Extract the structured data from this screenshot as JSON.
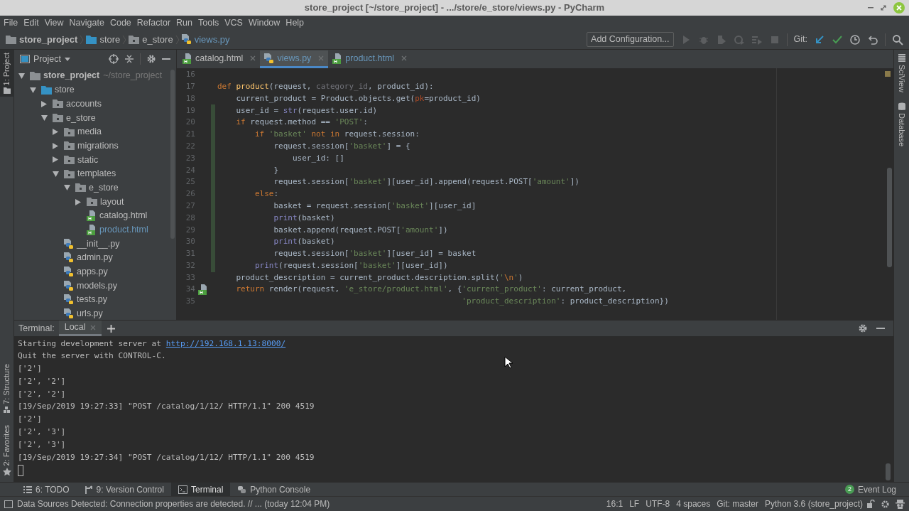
{
  "window": {
    "title": "store_project [~/store_project] - .../store/e_store/views.py - PyCharm"
  },
  "menu": [
    "File",
    "Edit",
    "View",
    "Navigate",
    "Code",
    "Refactor",
    "Run",
    "Tools",
    "VCS",
    "Window",
    "Help"
  ],
  "breadcrumb": [
    {
      "label": "store_project",
      "kind": "root"
    },
    {
      "label": "store",
      "kind": "source"
    },
    {
      "label": "e_store",
      "kind": "module"
    },
    {
      "label": "views.py",
      "kind": "py"
    }
  ],
  "toolbar": {
    "add_configuration": "Add Configuration...",
    "git_label": "Git:"
  },
  "left_stripe": {
    "top": [
      {
        "label": "1: Project",
        "selected": true
      }
    ],
    "bottom": [
      {
        "label": "7: Structure",
        "selected": false
      },
      {
        "label": "2: Favorites",
        "selected": false
      }
    ]
  },
  "right_stripe": [
    {
      "label": "SciView",
      "kind": "sciview"
    },
    {
      "label": "Database",
      "kind": "database"
    }
  ],
  "project_panel": {
    "title": "Project",
    "tree": [
      {
        "label": "store_project",
        "note": "~/store_project",
        "kind": "root",
        "expanded": true,
        "children": [
          {
            "label": "store",
            "kind": "source",
            "expanded": true,
            "children": [
              {
                "label": "accounts",
                "kind": "module",
                "expanded": false
              },
              {
                "label": "e_store",
                "kind": "module",
                "expanded": true,
                "children": [
                  {
                    "label": "media",
                    "kind": "module",
                    "expanded": false
                  },
                  {
                    "label": "migrations",
                    "kind": "module",
                    "expanded": false
                  },
                  {
                    "label": "static",
                    "kind": "module",
                    "expanded": false
                  },
                  {
                    "label": "templates",
                    "kind": "module",
                    "expanded": true,
                    "children": [
                      {
                        "label": "e_store",
                        "kind": "module",
                        "expanded": true,
                        "children": [
                          {
                            "label": "layout",
                            "kind": "module",
                            "expanded": false
                          },
                          {
                            "label": "catalog.html",
                            "kind": "html",
                            "modified": false
                          },
                          {
                            "label": "product.html",
                            "kind": "html",
                            "modified": true
                          }
                        ]
                      }
                    ]
                  },
                  {
                    "label": "__init__.py",
                    "kind": "py",
                    "modified": false
                  },
                  {
                    "label": "admin.py",
                    "kind": "py",
                    "modified": false
                  },
                  {
                    "label": "apps.py",
                    "kind": "py",
                    "modified": false
                  },
                  {
                    "label": "models.py",
                    "kind": "py",
                    "modified": false
                  },
                  {
                    "label": "tests.py",
                    "kind": "py",
                    "modified": false
                  },
                  {
                    "label": "urls.py",
                    "kind": "py",
                    "modified": false
                  }
                ]
              }
            ]
          }
        ]
      }
    ]
  },
  "tabs": [
    {
      "label": "catalog.html",
      "kind": "html",
      "selected": false,
      "modified": false
    },
    {
      "label": "views.py",
      "kind": "py",
      "selected": true,
      "modified": true
    },
    {
      "label": "product.html",
      "kind": "html",
      "selected": false,
      "modified": true
    }
  ],
  "code_lines": [
    {
      "number": "16",
      "changed": false,
      "template_link": false
    },
    {
      "number": "17",
      "changed": false,
      "template_link": false,
      "tokens": [
        {
          "text": "def ",
          "kind": "keyword"
        },
        {
          "text": "product",
          "kind": "function"
        },
        {
          "text": "(request, ",
          "kind": "plain"
        },
        {
          "text": "category_id",
          "kind": "unused"
        },
        {
          "text": ", product_id):",
          "kind": "plain"
        }
      ]
    },
    {
      "number": "18",
      "changed": false,
      "template_link": false,
      "tokens": [
        {
          "text": "    current_product = Product.objects.get(",
          "kind": "plain"
        },
        {
          "text": "pk",
          "kind": "kwarg"
        },
        {
          "text": "=product_id)",
          "kind": "plain"
        }
      ]
    },
    {
      "number": "19",
      "changed": true,
      "template_link": false,
      "tokens": [
        {
          "text": "    user_id = ",
          "kind": "plain"
        },
        {
          "text": "str",
          "kind": "builtin"
        },
        {
          "text": "(request.user.id)",
          "kind": "plain"
        }
      ]
    },
    {
      "number": "20",
      "changed": true,
      "template_link": false,
      "tokens": [
        {
          "text": "    if",
          "kind": "keyword"
        },
        {
          "text": " request.method == ",
          "kind": "plain"
        },
        {
          "text": "'POST'",
          "kind": "string"
        },
        {
          "text": ":",
          "kind": "plain"
        }
      ]
    },
    {
      "number": "21",
      "changed": true,
      "template_link": false,
      "tokens": [
        {
          "text": "        if ",
          "kind": "keyword"
        },
        {
          "text": "'basket'",
          "kind": "string"
        },
        {
          "text": " not in ",
          "kind": "keyword"
        },
        {
          "text": "request.session:",
          "kind": "plain"
        }
      ]
    },
    {
      "number": "22",
      "changed": true,
      "template_link": false,
      "tokens": [
        {
          "text": "            request.session[",
          "kind": "plain"
        },
        {
          "text": "'basket'",
          "kind": "string"
        },
        {
          "text": "] = {",
          "kind": "plain"
        }
      ]
    },
    {
      "number": "23",
      "changed": true,
      "template_link": false,
      "tokens": [
        {
          "text": "                user_id: []",
          "kind": "plain"
        }
      ]
    },
    {
      "number": "24",
      "changed": true,
      "template_link": false,
      "tokens": [
        {
          "text": "            }",
          "kind": "plain"
        }
      ]
    },
    {
      "number": "25",
      "changed": true,
      "template_link": false,
      "tokens": [
        {
          "text": "            request.session[",
          "kind": "plain"
        },
        {
          "text": "'basket'",
          "kind": "string"
        },
        {
          "text": "][user_id].append(request.POST[",
          "kind": "plain"
        },
        {
          "text": "'amount'",
          "kind": "string"
        },
        {
          "text": "])",
          "kind": "plain"
        }
      ]
    },
    {
      "number": "26",
      "changed": true,
      "template_link": false,
      "tokens": [
        {
          "text": "        else",
          "kind": "keyword"
        },
        {
          "text": ":",
          "kind": "plain"
        }
      ]
    },
    {
      "number": "27",
      "changed": true,
      "template_link": false,
      "tokens": [
        {
          "text": "            basket = request.session[",
          "kind": "plain"
        },
        {
          "text": "'basket'",
          "kind": "string"
        },
        {
          "text": "][user_id]",
          "kind": "plain"
        }
      ]
    },
    {
      "number": "28",
      "changed": true,
      "template_link": false,
      "tokens": [
        {
          "text": "            print",
          "kind": "builtin"
        },
        {
          "text": "(basket)",
          "kind": "plain"
        }
      ]
    },
    {
      "number": "29",
      "changed": true,
      "template_link": false,
      "tokens": [
        {
          "text": "            basket.append(request.POST[",
          "kind": "plain"
        },
        {
          "text": "'amount'",
          "kind": "string"
        },
        {
          "text": "])",
          "kind": "plain"
        }
      ]
    },
    {
      "number": "30",
      "changed": true,
      "template_link": false,
      "tokens": [
        {
          "text": "            print",
          "kind": "builtin"
        },
        {
          "text": "(basket)",
          "kind": "plain"
        }
      ]
    },
    {
      "number": "31",
      "changed": true,
      "template_link": false,
      "tokens": [
        {
          "text": "            request.session[",
          "kind": "plain"
        },
        {
          "text": "'basket'",
          "kind": "string"
        },
        {
          "text": "][user_id] = basket",
          "kind": "plain"
        }
      ]
    },
    {
      "number": "32",
      "changed": true,
      "template_link": false,
      "tokens": [
        {
          "text": "        print",
          "kind": "builtin"
        },
        {
          "text": "(request.session[",
          "kind": "plain"
        },
        {
          "text": "'basket'",
          "kind": "string"
        },
        {
          "text": "][user_id])",
          "kind": "plain"
        }
      ]
    },
    {
      "number": "33",
      "changed": false,
      "template_link": false,
      "tokens": [
        {
          "text": "    product_description = current_product.description.split(",
          "kind": "plain"
        },
        {
          "text": "'",
          "kind": "string"
        },
        {
          "text": "\\n",
          "kind": "escape"
        },
        {
          "text": "'",
          "kind": "string"
        },
        {
          "text": ")",
          "kind": "plain"
        }
      ]
    },
    {
      "number": "34",
      "changed": false,
      "template_link": true,
      "tokens": [
        {
          "text": "    return",
          "kind": "keyword"
        },
        {
          "text": " render(request, ",
          "kind": "plain"
        },
        {
          "text": "'e_store/product.html'",
          "kind": "string"
        },
        {
          "text": ", {",
          "kind": "plain"
        },
        {
          "text": "'current_product'",
          "kind": "string"
        },
        {
          "text": ": current_product,",
          "kind": "plain"
        }
      ]
    },
    {
      "number": "35",
      "changed": false,
      "template_link": false,
      "tokens": [
        {
          "text": "                                                    'product_description'",
          "kind": "string"
        },
        {
          "text": ": product_description})",
          "kind": "plain"
        }
      ]
    }
  ],
  "terminal": {
    "label": "Terminal:",
    "tabs": [
      {
        "label": "Local",
        "selected": true
      }
    ],
    "lines": [
      {
        "text": "Starting development server at ",
        "link": "http://192.168.1.13:8000/"
      },
      {
        "text": "Quit the server with CONTROL-C."
      },
      {
        "text": "['2']"
      },
      {
        "text": "['2', '2']"
      },
      {
        "text": "['2', '2']"
      },
      {
        "text": "[19/Sep/2019 19:27:33] \"POST /catalog/1/12/ HTTP/1.1\" 200 4519"
      },
      {
        "text": "['2']"
      },
      {
        "text": "['2', '3']"
      },
      {
        "text": "['2', '3']"
      },
      {
        "text": "[19/Sep/2019 19:27:34] \"POST /catalog/1/12/ HTTP/1.1\" 200 4519"
      }
    ]
  },
  "tool_tabs": [
    {
      "label": "6: TODO",
      "kind": "todo",
      "selected": false
    },
    {
      "label": "9: Version Control",
      "kind": "vcs",
      "selected": false
    },
    {
      "label": "Terminal",
      "kind": "terminal",
      "selected": true
    },
    {
      "label": "Python Console",
      "kind": "python",
      "selected": false
    }
  ],
  "event_log": {
    "count": "2",
    "label": "Event Log"
  },
  "status_bar": {
    "message": "Data Sources Detected: Connection properties are detected. // ... (today 12:04 PM)",
    "items": [
      "16:1",
      "LF",
      "UTF-8",
      "4 spaces",
      "Git: master",
      "Python 3.6 (store_project)"
    ]
  }
}
